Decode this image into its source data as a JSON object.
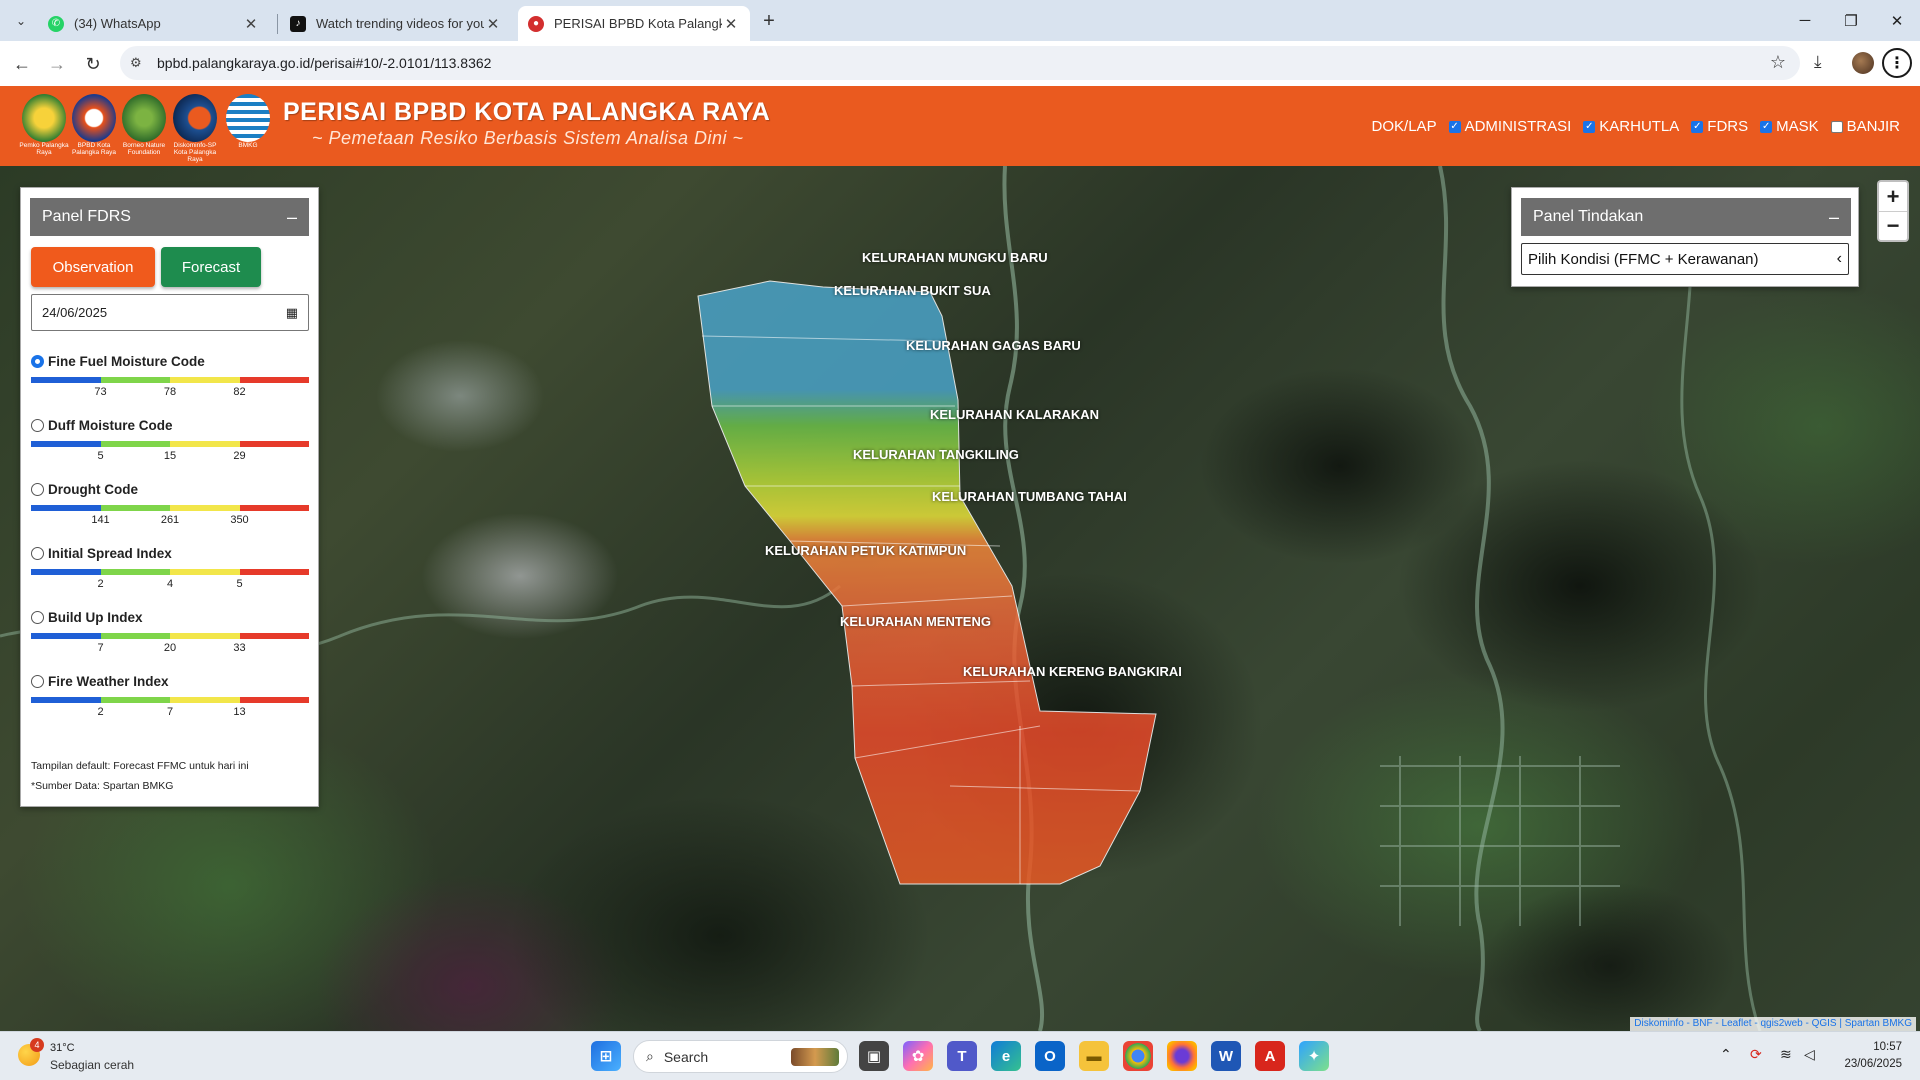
{
  "browser": {
    "tabs": [
      {
        "title": "(34) WhatsApp",
        "icon": "whatsapp-icon"
      },
      {
        "title": "Watch trending videos for you |",
        "icon": "tiktok-icon"
      },
      {
        "title": "PERISAI BPBD Kota Palangka Ra",
        "icon": "bpbd-icon",
        "active": true
      }
    ],
    "url": "bpbd.palangkaraya.go.id/perisai#10/-2.0101/113.8362"
  },
  "header": {
    "logos": [
      {
        "caption": "Pemko Palangka Raya",
        "color": "#2e7d32"
      },
      {
        "caption": "BPBD Kota Palangka Raya",
        "color": "#e8501a"
      },
      {
        "caption": "Borneo Nature Foundation",
        "color": "#2f6b2a"
      },
      {
        "caption": "Diskominfo-SP Kota Palangka Raya",
        "color": "#1d4f91"
      },
      {
        "caption": "BMKG",
        "color": "#1b7fc4"
      }
    ],
    "title": "PERISAI BPBD KOTA PALANGKA RAYA",
    "subtitle": "~ Pemetaan Resiko Berbasis Sistem Analisa Dini ~",
    "menu": {
      "doklap": "DOK/LAP",
      "layers": [
        {
          "label": "ADMINISTRASI",
          "checked": true
        },
        {
          "label": "KARHUTLA",
          "checked": true
        },
        {
          "label": "FDRS",
          "checked": true
        },
        {
          "label": "MASK",
          "checked": true
        },
        {
          "label": "BANJIR",
          "checked": false
        }
      ]
    }
  },
  "panel_fdrs": {
    "title": "Panel FDRS",
    "minimize": "–",
    "observation_label": "Observation",
    "forecast_label": "Forecast",
    "date_value": "24/06/2025",
    "scale_colors": [
      "#1f5fd6",
      "#7fd54a",
      "#f2e64a",
      "#e63a2a"
    ],
    "indices": [
      {
        "label": "Fine Fuel Moisture Code",
        "selected": true,
        "ticks": [
          "73",
          "78",
          "82"
        ]
      },
      {
        "label": "Duff Moisture Code",
        "selected": false,
        "ticks": [
          "5",
          "15",
          "29"
        ]
      },
      {
        "label": "Drought Code",
        "selected": false,
        "ticks": [
          "141",
          "261",
          "350"
        ]
      },
      {
        "label": "Initial Spread Index",
        "selected": false,
        "ticks": [
          "2",
          "4",
          "5"
        ]
      },
      {
        "label": "Build Up Index",
        "selected": false,
        "ticks": [
          "7",
          "20",
          "33"
        ]
      },
      {
        "label": "Fire Weather Index",
        "selected": false,
        "ticks": [
          "2",
          "7",
          "13"
        ]
      }
    ],
    "note_default": "Tampilan default: Forecast FFMC untuk hari ini",
    "note_source": "*Sumber Data: Spartan BMKG"
  },
  "panel_tindakan": {
    "title": "Panel Tindakan",
    "minimize": "–",
    "select_value": "Pilih Kondisi (FFMC + Kerawanan)"
  },
  "map": {
    "zoom_in": "+",
    "zoom_out": "−",
    "kelurahan": [
      "KELURAHAN MUNGKU BARU",
      "KELURAHAN BUKIT SUA",
      "KELURAHAN GAGAS BARU",
      "KELURAHAN KALARAKAN",
      "KELURAHAN TANGKILING",
      "KELURAHAN TUMBANG TAHAI",
      "KELURAHAN PETUK KATIMPUN",
      "KELURAHAN MENTENG",
      "KELURAHAN KERENG BANGKIRAI"
    ],
    "attribution": "Diskominfo - BNF - Leaflet - qgis2web - QGIS | Spartan BMKG"
  },
  "taskbar": {
    "weather_temp": "31°C",
    "weather_desc": "Sebagian cerah",
    "weather_badge": "4",
    "search_placeholder": "Search",
    "time": "10:57",
    "date": "23/06/2025"
  }
}
